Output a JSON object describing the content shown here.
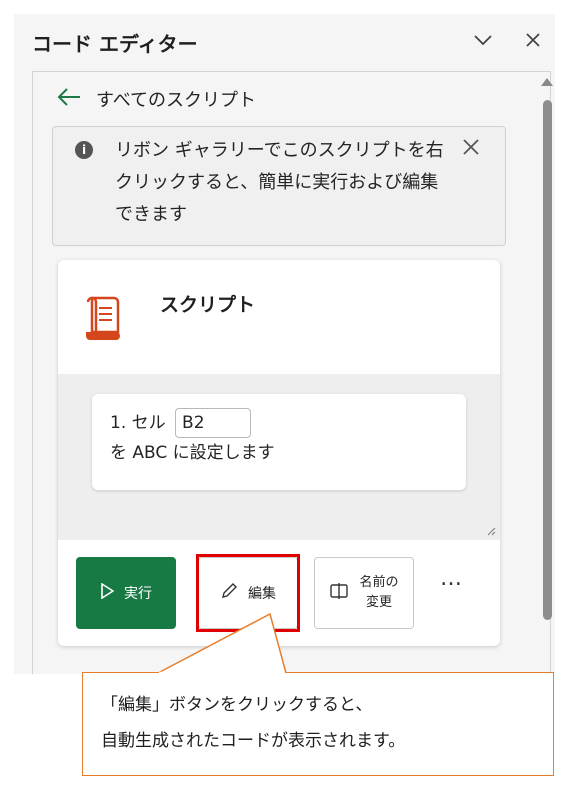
{
  "pane": {
    "title": "コード エディター",
    "collapse_icon": "chevron-down-icon",
    "close_icon": "close-icon"
  },
  "back": {
    "label": "すべてのスクリプト",
    "icon": "arrow-left-icon"
  },
  "banner": {
    "icon": "info-icon",
    "text": "リボン ギャラリーでこのスクリプトを右クリックすると、簡単に実行および編集できます",
    "close_icon": "close-icon"
  },
  "card": {
    "icon": "script-icon",
    "title": "スクリプト",
    "step": {
      "prefix": "1. セル",
      "cell": "B2",
      "suffix": "を ABC に設定します"
    },
    "buttons": {
      "run": "実行",
      "edit": "編集",
      "rename": "名前の変更",
      "more": "…"
    }
  },
  "callout": {
    "line1": "「編集」ボタンをクリックすると、",
    "line2": "自動生成されたコードが表示されます。"
  },
  "colors": {
    "accent_green": "#177a45",
    "highlight_red": "#e00000",
    "callout_border": "#e87d2a"
  }
}
